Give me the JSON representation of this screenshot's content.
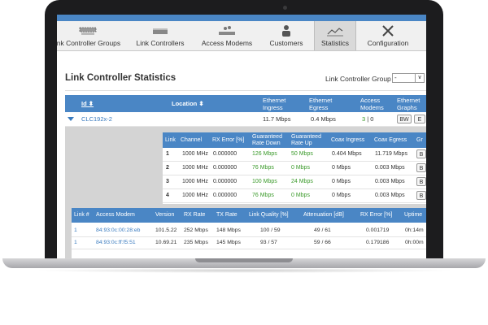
{
  "tabs": [
    {
      "label": "ink Controller Groups",
      "icon": "link-controller-groups-icon"
    },
    {
      "label": "Link Controllers",
      "icon": "link-controller-icon"
    },
    {
      "label": "Access Modems",
      "icon": "access-modems-icon"
    },
    {
      "label": "Customers",
      "icon": "customers-icon"
    },
    {
      "label": "Statistics",
      "icon": "statistics-icon",
      "active": true
    },
    {
      "label": "Configuration",
      "icon": "configuration-icon"
    }
  ],
  "page": {
    "title": "Link Controller Statistics",
    "group_label": "Link Controller Group",
    "group_value": "-"
  },
  "main_table": {
    "headers": {
      "id": "Id ⬍",
      "location": "Location ⬍",
      "eth_ingress": "Ethernet Ingress",
      "eth_egress": "Ethernet Egress",
      "access_modems": "Access Modems",
      "eth_graphs": "Ethernet Graphs"
    },
    "row": {
      "id": "CLC192x-2",
      "eth_ingress": "11.7 Mbps",
      "eth_egress": "0.4 Mbps",
      "modems_active": "3",
      "modems_rest": " | 0",
      "btn_bw": "BW",
      "btn_e": "E"
    }
  },
  "link_table": {
    "headers": [
      "Link",
      "Channel",
      "RX Error [%]",
      "Guaranteed Rate Down",
      "Guaranteed Rate Up",
      "Coax Ingress",
      "Coax Egress",
      "Gr"
    ],
    "rows": [
      {
        "link": "1",
        "channel": "1000 MHz",
        "rx_error": "0.000000",
        "rate_down": "126 Mbps",
        "rate_up": "50 Mbps",
        "coax_in": "0.404 Mbps",
        "coax_out": "11.719 Mbps",
        "btn": "B"
      },
      {
        "link": "2",
        "channel": "1000 MHz",
        "rx_error": "0.000000",
        "rate_down": "76 Mbps",
        "rate_up": "0 Mbps",
        "coax_in": "0 Mbps",
        "coax_out": "0.003 Mbps",
        "btn": "B"
      },
      {
        "link": "3",
        "channel": "1000 MHz",
        "rx_error": "0.000000",
        "rate_down": "100 Mbps",
        "rate_up": "24 Mbps",
        "coax_in": "0 Mbps",
        "coax_out": "0.003 Mbps",
        "btn": "B"
      },
      {
        "link": "4",
        "channel": "1000 MHz",
        "rx_error": "0.000000",
        "rate_down": "76 Mbps",
        "rate_up": "0 Mbps",
        "coax_in": "0 Mbps",
        "coax_out": "0.003 Mbps",
        "btn": "B"
      }
    ]
  },
  "modem_table": {
    "headers": [
      "Link #",
      "Access Modem",
      "Version",
      "RX Rate",
      "TX Rate",
      "Link Quality [%]",
      "Attenuation [dB]",
      "RX Error [%]",
      "Uptime"
    ],
    "rows": [
      {
        "link": "1",
        "modem": "84:93:0c:00:28:eb",
        "version": "101.5.22",
        "rx": "252 Mbps",
        "tx": "148 Mbps",
        "quality": "100 / 59",
        "atten": "49 / 61",
        "rx_error": "0.001719",
        "uptime": "0h:14m"
      },
      {
        "link": "1",
        "modem": "84:93:0c:ff:f5:51",
        "version": "10.69.21",
        "rx": "235 Mbps",
        "tx": "145 Mbps",
        "quality": "93 / 57",
        "atten": "59 / 66",
        "rx_error": "0.179186",
        "uptime": "0h:00m"
      }
    ]
  }
}
